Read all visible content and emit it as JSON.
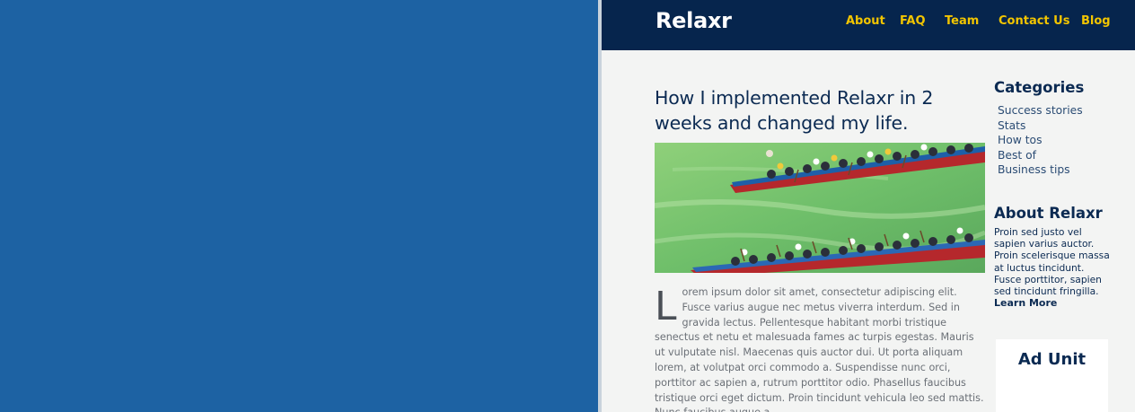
{
  "site": {
    "logo": "Relaxr",
    "nav": [
      "About",
      "FAQ",
      "Team",
      "Contact Us",
      "Blog"
    ]
  },
  "post": {
    "title": "How I implemented Relaxr in 2 weeks and changed my life.",
    "dropcap": "L",
    "body": "orem ipsum dolor sit amet, consectetur adipiscing elit. Fusce varius augue nec metus viverra interdum. Sed in gravida lectus. Pellentesque habitant morbi tristique senectus et netu et malesuada fames ac turpis egestas. Mauris ut vulputate nisl. Maecenas quis auctor dui. Ut porta aliquam lorem, at volutpat orci commodo a. Suspendisse nunc orci, porttitor ac sapien a, rutrum porttitor odio. Phasellus faucibus tristique orci eget dictum. Proin tincidunt vehicula leo sed mattis. Nunc faucibus augue a"
  },
  "sidebar": {
    "categories_heading": "Categories",
    "categories": [
      "Success stories",
      "Stats",
      "How tos",
      "Best of",
      "Business tips"
    ],
    "about_heading": "About Relaxr",
    "about_text": "Proin sed justo vel sapien varius auctor. Proin scelerisque massa at luctus tincidunt. Fusce porttitor, sapien sed tincidunt fringilla.",
    "learn_more": "Learn More"
  },
  "ad": {
    "label": "Ad Unit"
  },
  "colors": {
    "background_blue": "#1d62a3",
    "header_navy": "#06254d",
    "nav_yellow": "#f2c500",
    "page_bg": "#f3f4f3"
  }
}
